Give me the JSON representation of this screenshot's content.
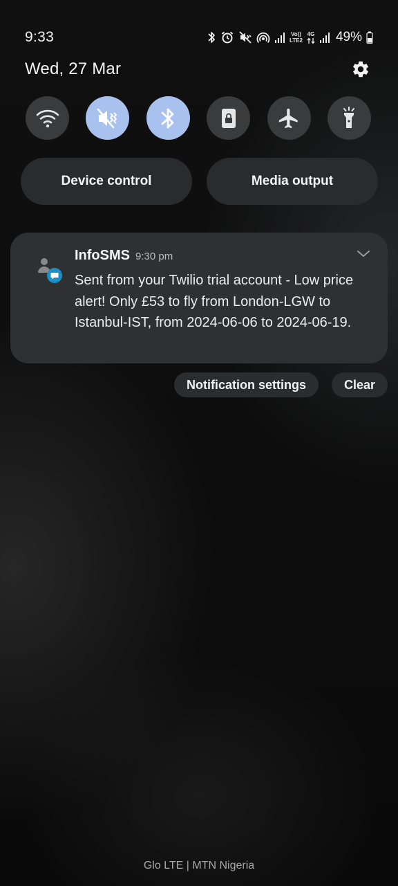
{
  "status_bar": {
    "time": "9:33",
    "network_volte": "Vo))",
    "network_lte2": "LTE2",
    "network_4g": "4G",
    "battery": "49%",
    "icons": [
      "bluetooth-icon",
      "alarm-icon",
      "mute-icon",
      "hotspot-icon",
      "signal-icon",
      "data-arrows-icon",
      "signal-icon",
      "battery-icon"
    ]
  },
  "header": {
    "date": "Wed, 27 Mar"
  },
  "quick_toggles": [
    {
      "icon": "wifi-icon",
      "state": "off"
    },
    {
      "icon": "mute-icon",
      "state": "on"
    },
    {
      "icon": "bluetooth-icon",
      "state": "on"
    },
    {
      "icon": "rotation-lock-icon",
      "state": "off"
    },
    {
      "icon": "airplane-icon",
      "state": "off"
    },
    {
      "icon": "flashlight-icon",
      "state": "off"
    }
  ],
  "panel_buttons": {
    "device_control": "Device control",
    "media_output": "Media output"
  },
  "notification": {
    "app": "InfoSMS",
    "time": "9:30 pm",
    "body": "Sent from your Twilio trial account - Low price alert! Only £53 to fly from London-LGW to Istanbul-IST, from 2024-06-06 to 2024-06-19."
  },
  "notification_actions": {
    "settings": "Notification settings",
    "clear": "Clear"
  },
  "carrier": "Glo LTE | MTN Nigeria",
  "colors": {
    "toggle_on": "#a9c1ee",
    "toggle_off": "#3a3b3d",
    "card": "#2f3031",
    "badge": "#1a8fc8"
  }
}
